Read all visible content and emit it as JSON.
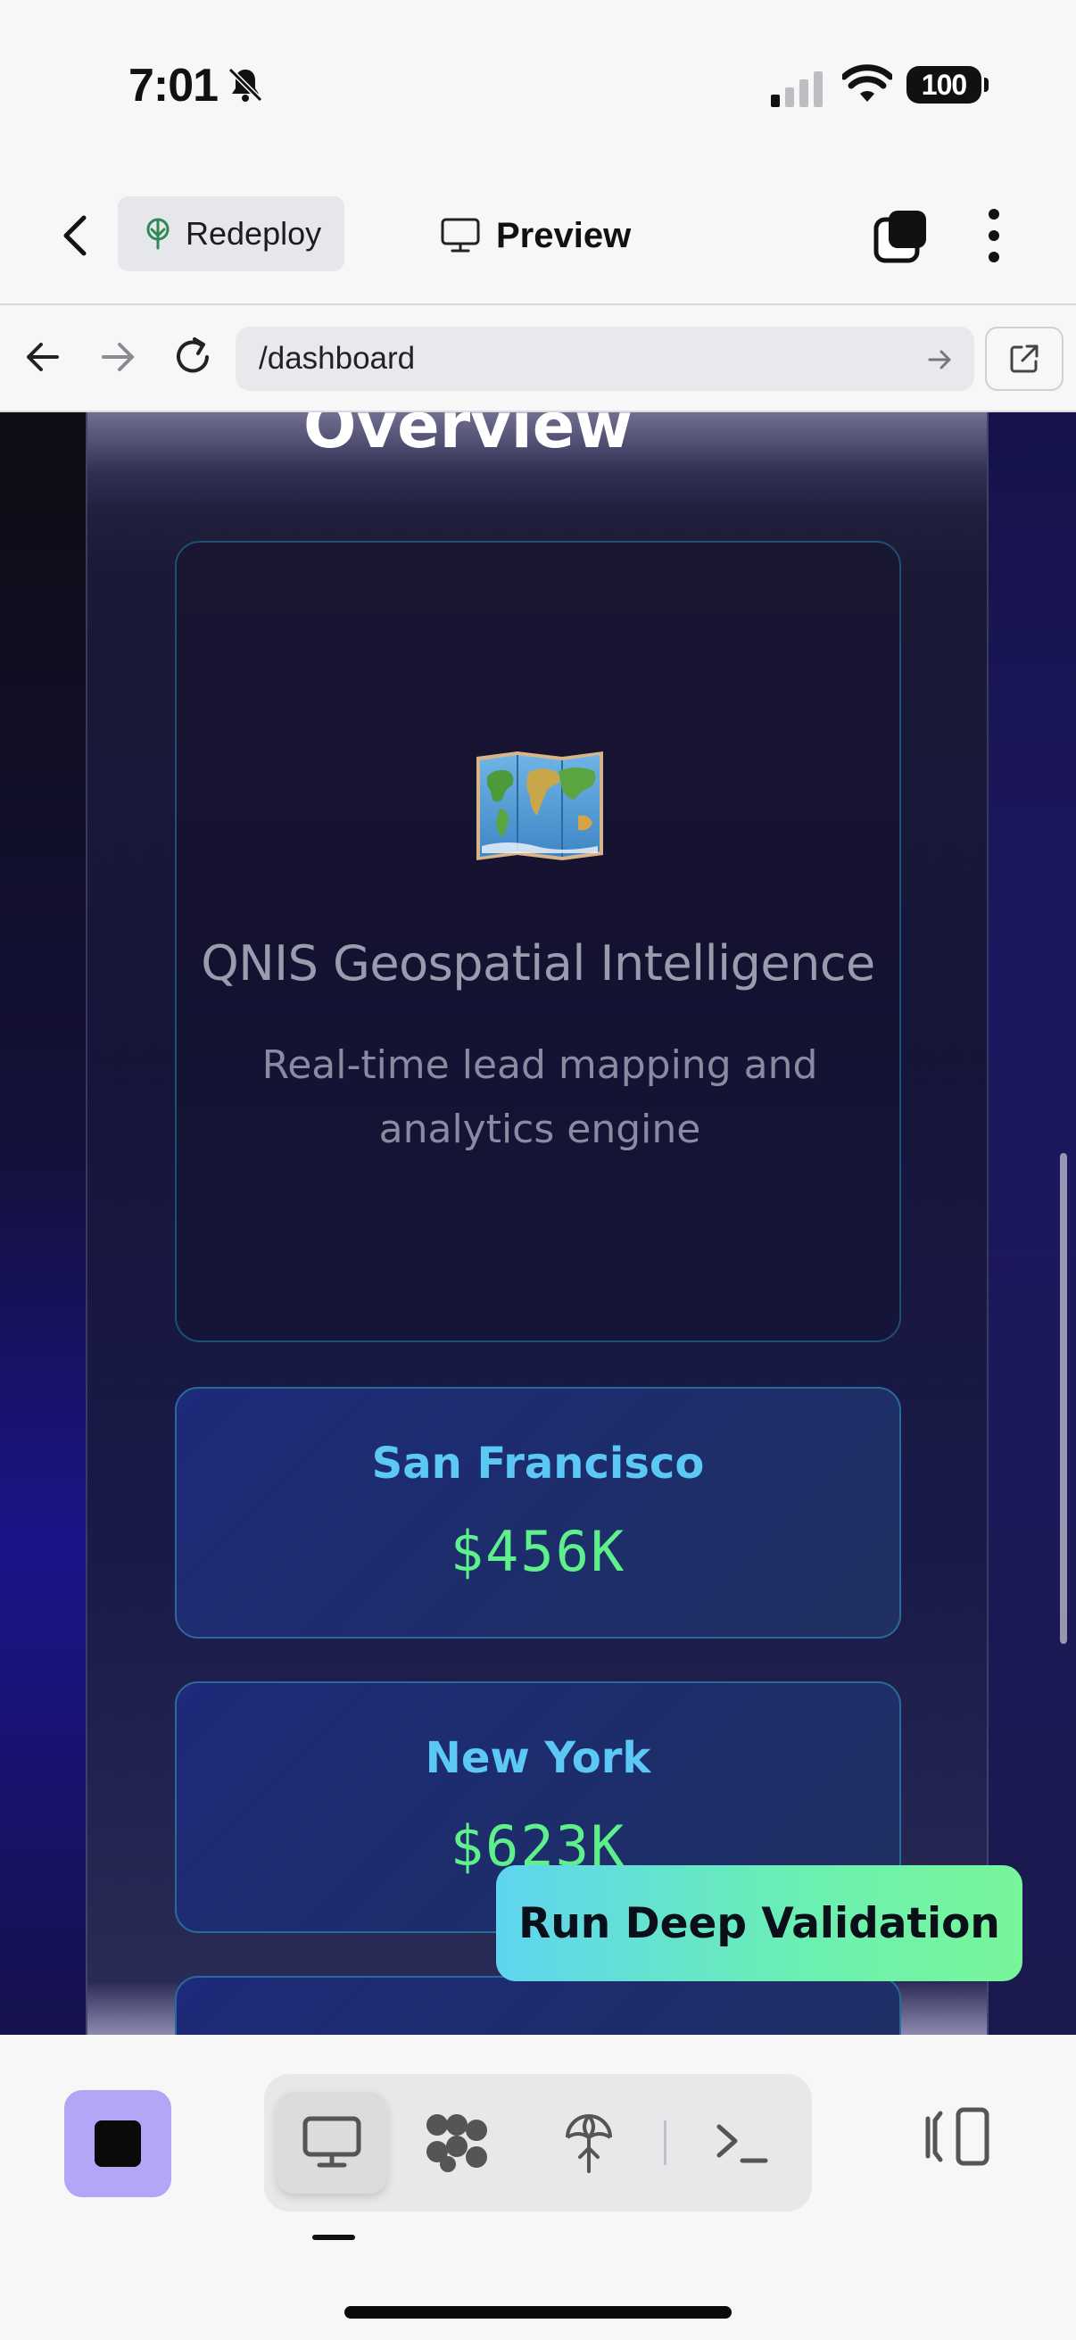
{
  "status_bar": {
    "time": "7:01",
    "battery": "100"
  },
  "app_bar": {
    "redeploy_label": "Redeploy",
    "preview_label": "Preview"
  },
  "url_bar": {
    "url": "/dashboard"
  },
  "page": {
    "section_title": "Overview",
    "hero": {
      "icon": "world-map-icon",
      "title": "QNIS Geospatial Intelligence",
      "subtitle": "Real-time lead mapping and analytics engine"
    },
    "cities": [
      {
        "name": "San Francisco",
        "value": "$456K"
      },
      {
        "name": "New York",
        "value": "$623K"
      }
    ],
    "cta_label": "Run Deep Validation"
  },
  "colors": {
    "accent_purple": "#b3a6f7",
    "city_name": "#5cc8f5",
    "city_value": "#5ef08a",
    "cta_start": "#5fd4f0",
    "cta_end": "#78f59a"
  },
  "bottom_bar": {
    "tools": [
      "desktop-preview-icon",
      "workflow-icon",
      "deploy-icon",
      "terminal-icon"
    ],
    "active_tool": "desktop-preview-icon"
  }
}
